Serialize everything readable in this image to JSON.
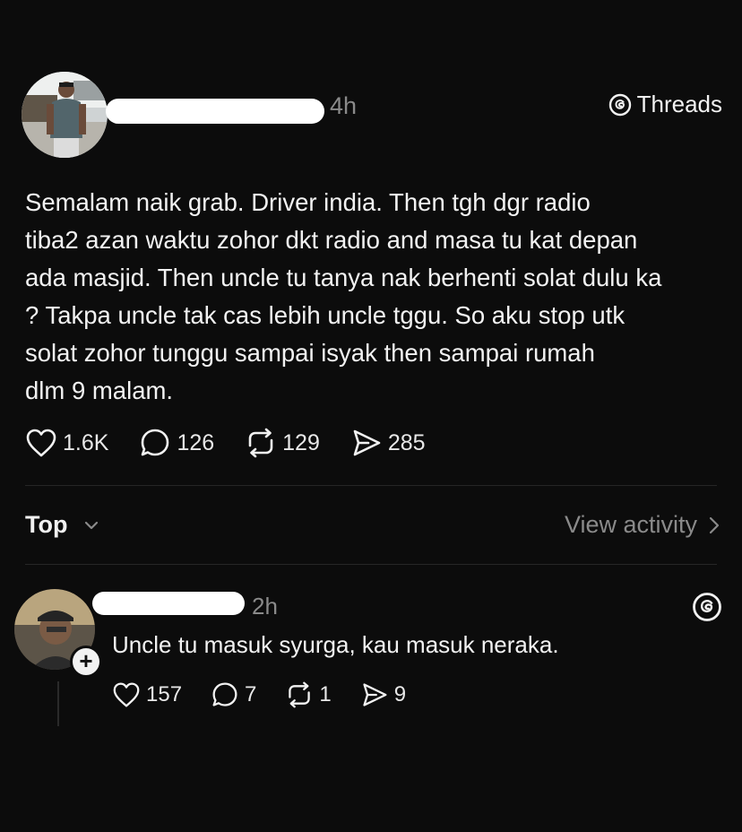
{
  "post": {
    "time": "4h",
    "app_label": "Threads",
    "body": "Semalam naik grab. Driver india. Then tgh dgr radio\ntiba2 azan waktu zohor dkt radio and masa tu kat depan\nada masjid. Then uncle tu tanya nak berhenti solat dulu ka\n? Takpa uncle tak cas lebih uncle tggu. So aku stop utk\nsolat zohor tunggu sampai isyak then sampai rumah\ndlm 9 malam.",
    "likes": "1.6K",
    "replies": "126",
    "reposts": "129",
    "shares": "285"
  },
  "sort": {
    "label": "Top",
    "activity_label": "View activity"
  },
  "reply": {
    "time": "2h",
    "body": "Uncle tu masuk syurga, kau masuk neraka.",
    "likes": "157",
    "replies": "7",
    "reposts": "1",
    "shares": "9",
    "follow_symbol": "+"
  },
  "icons": {
    "like": "heart-icon",
    "reply": "comment-icon",
    "repost": "repost-icon",
    "share": "send-icon",
    "threads": "threads-logo-icon",
    "chevron": "chevron-icon"
  },
  "colors": {
    "background": "#0c0c0c",
    "text": "#f2f2f2",
    "muted": "#8a8a8a",
    "divider": "#262626"
  }
}
